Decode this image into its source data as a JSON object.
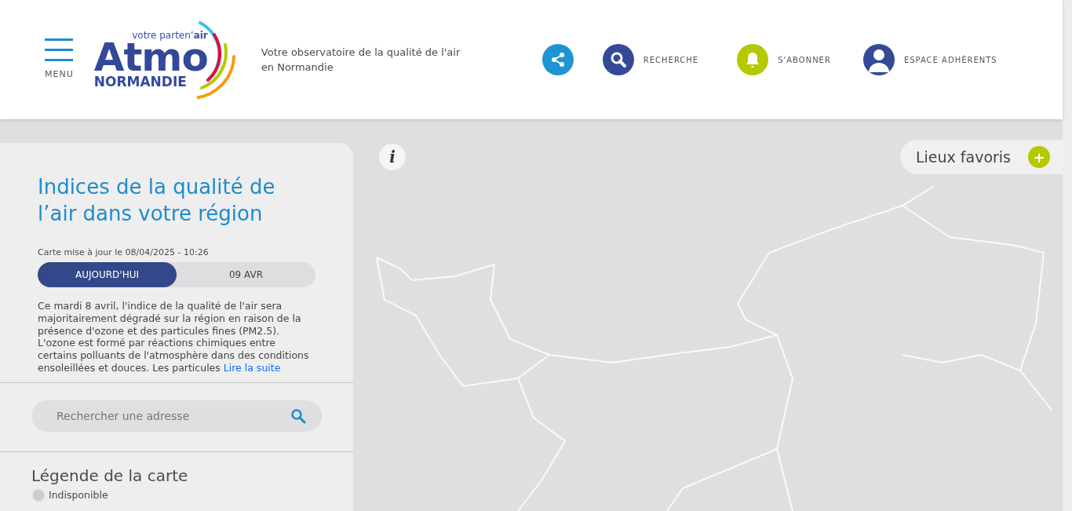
{
  "header": {
    "menu_label": "MENU",
    "logo": {
      "tagline": "votre parten’**air**",
      "name": "Atmo",
      "region": "NORMANDIE"
    },
    "slogan": "Votre observatoire de la qualité de l'air en Normandie",
    "actions": [
      {
        "kind": "share"
      },
      {
        "kind": "search",
        "label": "RECHERCHE"
      },
      {
        "kind": "bell",
        "label": "S'ABONNER"
      },
      {
        "kind": "user",
        "label": "ESPACE ADHÉRENTS"
      }
    ]
  },
  "panel": {
    "title": "Indices de la qualité de l’air dans votre région",
    "updated": "Carte mise à jour le 08/04/2025 - 10:26",
    "days": [
      {
        "label": "AUJOURD'HUI",
        "selected": true
      },
      {
        "label": "09 AVR",
        "selected": false
      }
    ],
    "description": "Ce mardi 8 avril, l'indice de la qualité de l'air sera majoritairement dégradé sur la région en raison de la présence d'ozone et des particules fines (PM2.5). L'ozone est formé par réactions chimiques entre certains polluants de l'atmosphère dans des conditions ensoleillées et douces. Les particules",
    "read_more": "Lire la suite",
    "search": {
      "placeholder": "Rechercher une adresse"
    },
    "legend": {
      "title": "Légende de la carte",
      "items": [
        {
          "label": "Indisponible",
          "color": "#cccccc"
        }
      ]
    }
  },
  "map": {
    "info": "i",
    "favorites": "Lieux favoris",
    "favorites_add": "+"
  }
}
